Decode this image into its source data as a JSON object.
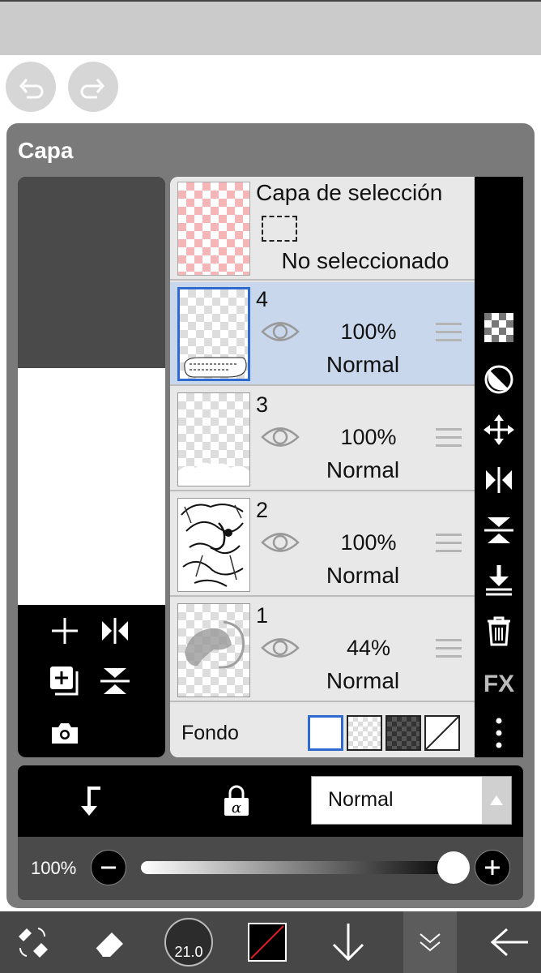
{
  "panel": {
    "title": "Capa"
  },
  "selection_layer": {
    "title": "Capa de selección",
    "status": "No seleccionado"
  },
  "layers": [
    {
      "number": "4",
      "opacity": "100%",
      "blend": "Normal"
    },
    {
      "number": "3",
      "opacity": "100%",
      "blend": "Normal"
    },
    {
      "number": "2",
      "opacity": "100%",
      "blend": "Normal"
    },
    {
      "number": "1",
      "opacity": "44%",
      "blend": "Normal"
    }
  ],
  "background": {
    "label": "Fondo"
  },
  "side_tools": {
    "fx_label": "FX"
  },
  "blend_mode": {
    "selected": "Normal"
  },
  "opacity_slider": {
    "label": "100%",
    "fraction": 1.0
  },
  "toolbar": {
    "brush_size": "21.0"
  },
  "colors": {
    "accent": "#2f6ad0",
    "selected_row": "#c9d7ec",
    "panel": "#7a7a7a"
  }
}
